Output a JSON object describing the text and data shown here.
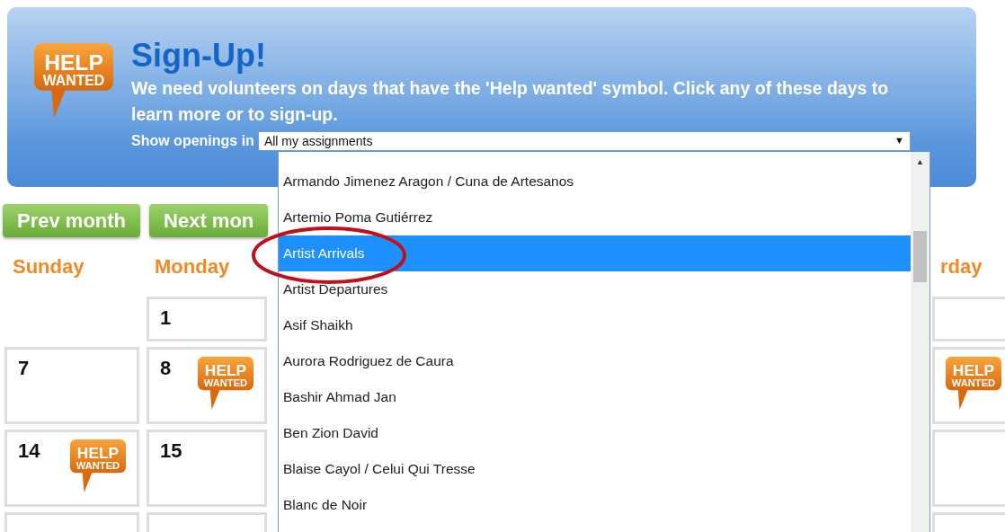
{
  "header": {
    "badge": {
      "top": "HELP",
      "bottom": "WANTED"
    },
    "title": "Sign-Up!",
    "description": "We need volunteers on days that have the 'Help wanted' symbol. Click any of these days to learn more or to sign-up.",
    "filter_label": "Show openings in",
    "select": {
      "value": "All my assignments",
      "arrow": "▼",
      "expanded": true
    }
  },
  "nav_buttons": [
    {
      "label": "Prev month"
    },
    {
      "label": "Next mon"
    }
  ],
  "calendar": {
    "headers": [
      {
        "label": "Sunday"
      },
      {
        "label": "Monday"
      },
      {
        "label": "rday"
      }
    ],
    "weeks": [
      {
        "cells": [
          {
            "kind": "blank"
          },
          {
            "kind": "day",
            "number": "1"
          },
          {
            "kind": "day"
          }
        ]
      },
      {
        "cells": [
          {
            "kind": "day",
            "number": "7"
          },
          {
            "kind": "day",
            "number": "8",
            "badge": {
              "top": "HELP",
              "bottom": "WANTED"
            }
          },
          {
            "kind": "day",
            "badge": {
              "top": "HELP",
              "bottom": "WANTED"
            }
          }
        ]
      },
      {
        "cells": [
          {
            "kind": "day",
            "number": "14",
            "badge": {
              "top": "HELP",
              "bottom": "WANTED"
            }
          },
          {
            "kind": "day",
            "number": "15"
          },
          {
            "kind": "day"
          }
        ]
      },
      {
        "cells": [
          {
            "kind": "day"
          },
          {
            "kind": "day"
          },
          {
            "kind": "day"
          }
        ]
      }
    ]
  },
  "dropdown": {
    "scroll_up": "▲",
    "options": [
      {
        "label": "Armando Jimenez Aragon / Cuna de Artesanos",
        "selected": false
      },
      {
        "label": "Artemio Poma Gutiérrez",
        "selected": false
      },
      {
        "label": "Artist Arrivals",
        "selected": true
      },
      {
        "label": "Artist Departures",
        "selected": false
      },
      {
        "label": "Asif Shaikh",
        "selected": false
      },
      {
        "label": "Aurora Rodriguez de Caura",
        "selected": false
      },
      {
        "label": "Bashir Ahmad Jan",
        "selected": false
      },
      {
        "label": "Ben Zion David",
        "selected": false
      },
      {
        "label": "Blaise Cayol / Celui Qui Tresse",
        "selected": false
      },
      {
        "label": "Blanc de Noir",
        "selected": false
      }
    ]
  },
  "annotation": {
    "kind": "ellipse"
  }
}
